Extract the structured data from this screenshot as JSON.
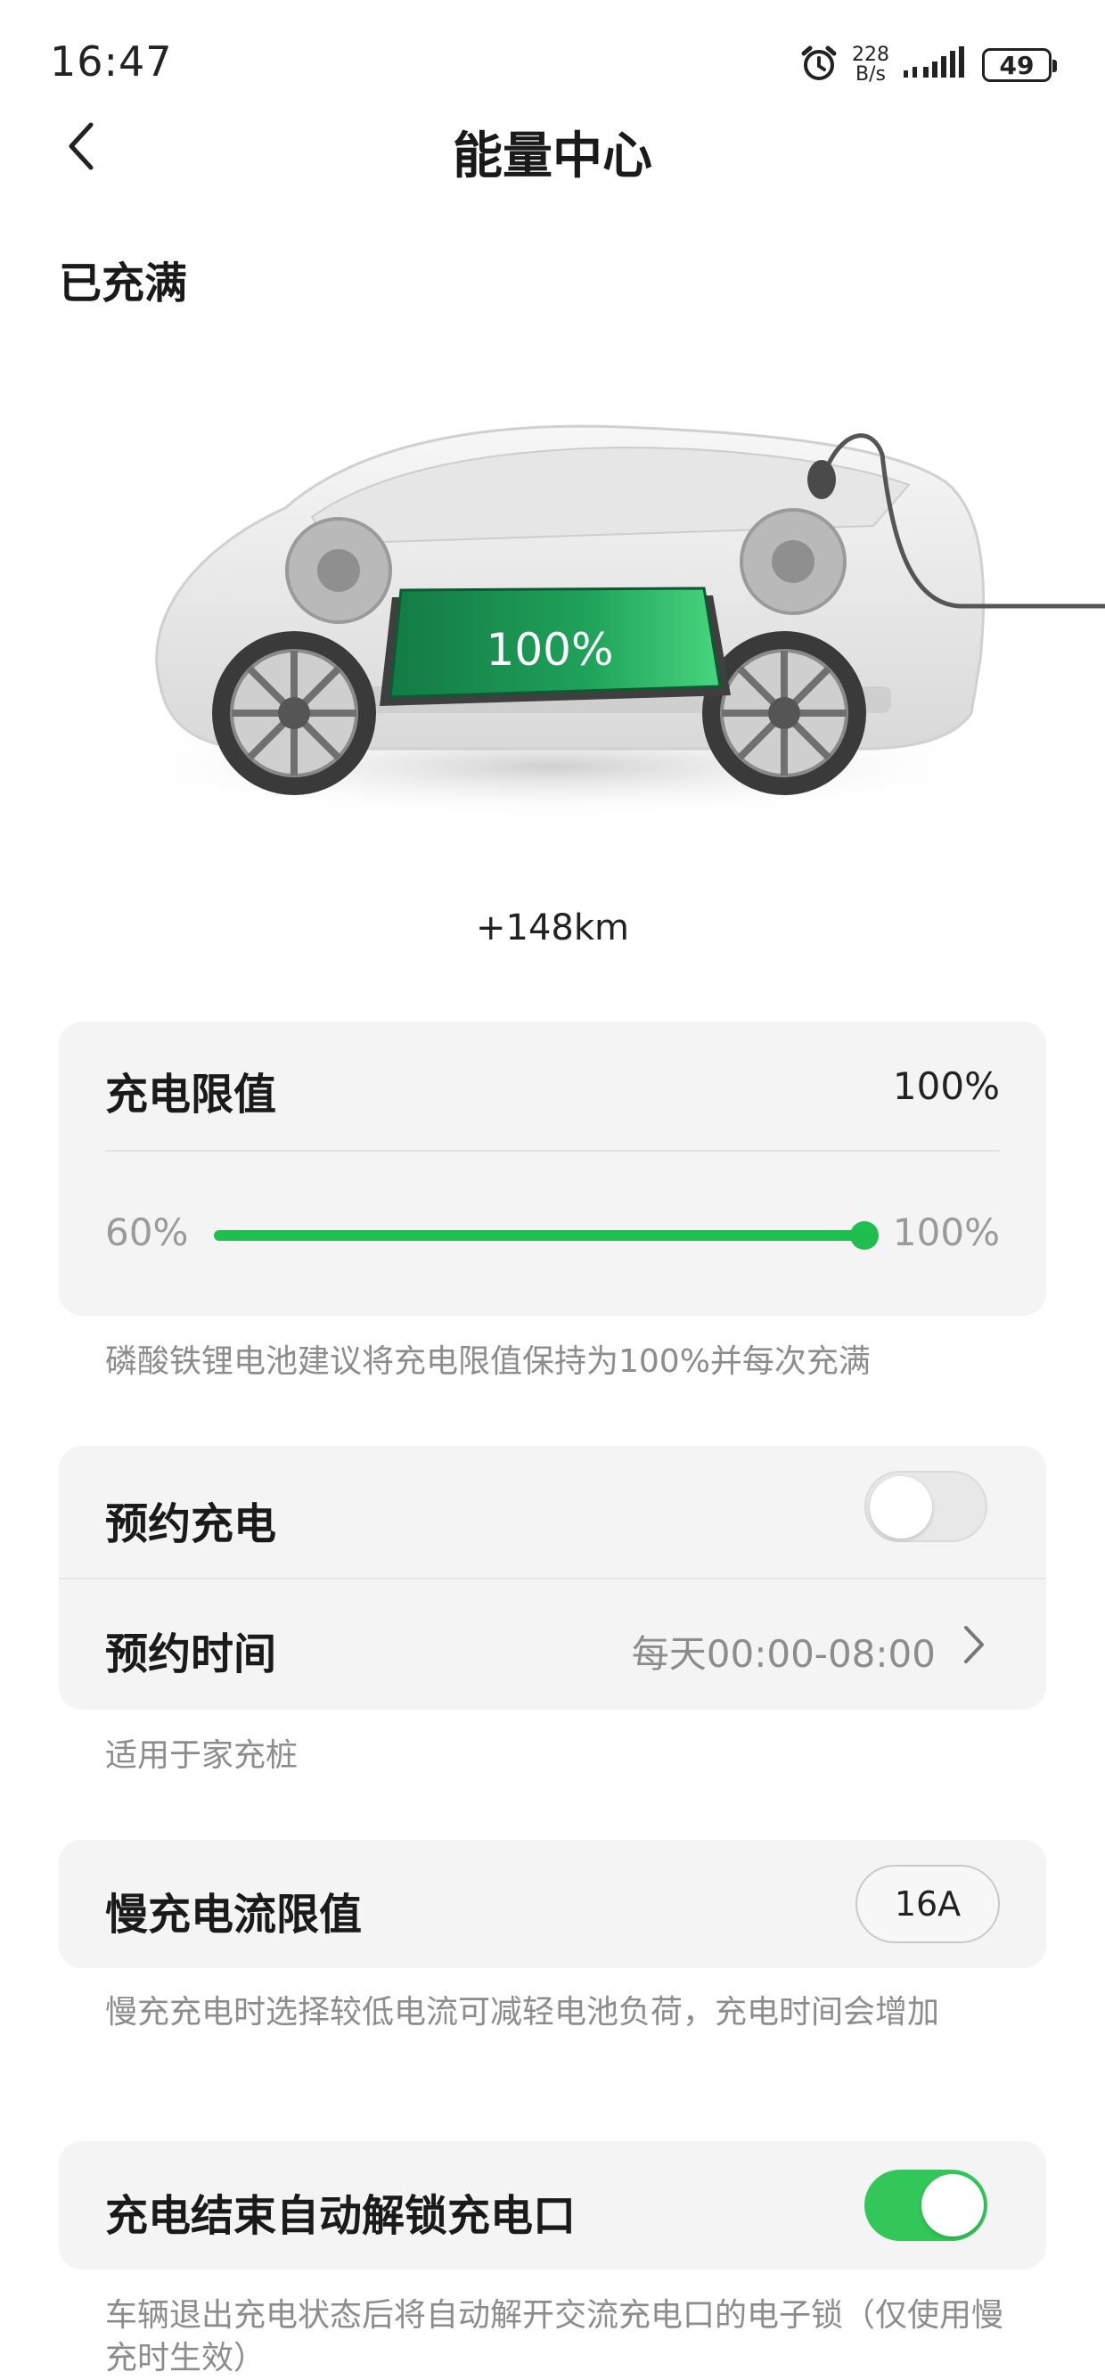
{
  "status_bar": {
    "time": "16:47",
    "net_speed_value": "228",
    "net_speed_unit": "B/s",
    "battery": "49",
    "icons": [
      "alarm-icon",
      "signal-icon",
      "battery-icon"
    ]
  },
  "header": {
    "title": "能量中心",
    "back_icon": "chevron-left-icon"
  },
  "charge": {
    "status": "已充满",
    "battery_percent_label": "100%",
    "battery_level": 1.0,
    "range_added": "+148km"
  },
  "charge_limit": {
    "title": "充电限值",
    "value": "100%",
    "slider_min_label": "60%",
    "slider_max_label": "100%",
    "slider_fraction": 1.0,
    "hint": "磷酸铁锂电池建议将充电限值保持为100%并每次充满"
  },
  "schedule": {
    "charge_title": "预约充电",
    "charge_enabled": false,
    "time_title": "预约时间",
    "time_value": "每天00:00-08:00",
    "hint": "适用于家充桩"
  },
  "slow_charge": {
    "title": "慢充电流限值",
    "value": "16A",
    "hint": "慢充充电时选择较低电流可减轻电池负荷，充电时间会增加"
  },
  "auto_unlock": {
    "title": "充电结束自动解锁充电口",
    "enabled": true,
    "hint": "车辆退出充电状态后将自动解开交流充电口的电子锁（仅使用慢充时生效）"
  },
  "colors": {
    "accent_green": "#1ebe4f",
    "toggle_on": "#33c75a",
    "card_bg": "#f4f4f4",
    "hint_text": "#8c8c8c"
  }
}
